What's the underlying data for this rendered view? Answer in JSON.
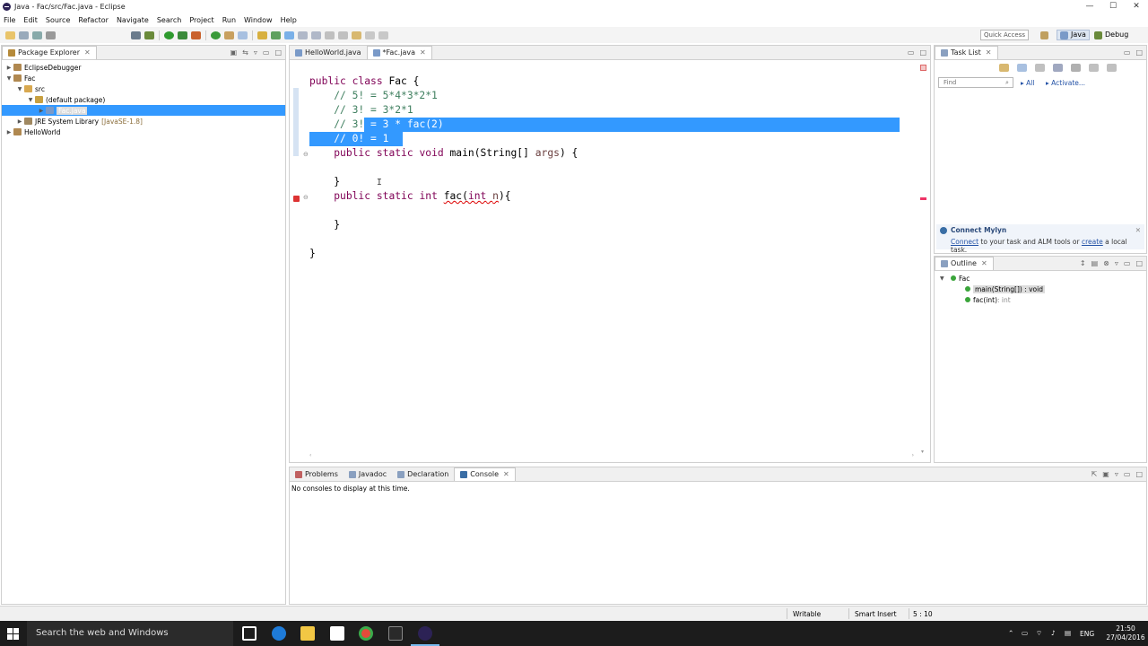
{
  "window": {
    "title": "Java - Fac/src/Fac.java - Eclipse",
    "controls": {
      "minimize": "—",
      "maximize": "☐",
      "close": "✕"
    }
  },
  "menu": [
    "File",
    "Edit",
    "Source",
    "Refactor",
    "Navigate",
    "Search",
    "Project",
    "Run",
    "Window",
    "Help"
  ],
  "toolbar": {
    "quick_access": "Quick Access",
    "perspectives": {
      "java": "Java",
      "debug": "Debug"
    }
  },
  "package_explorer": {
    "tab_label": "Package Explorer",
    "tree": [
      {
        "label": "EclipseDebugger",
        "extra": ""
      },
      {
        "label": "Fac",
        "extra": ""
      },
      {
        "label": "src",
        "extra": ""
      },
      {
        "label": "(default package)",
        "extra": ""
      },
      {
        "label": "Fac.java",
        "extra": ""
      },
      {
        "label": "JRE System Library",
        "extra": "[JavaSE-1.8]"
      },
      {
        "label": "HelloWorld",
        "extra": ""
      }
    ]
  },
  "editor": {
    "tabs": [
      {
        "label": "HelloWorld.java"
      },
      {
        "label": "*Fac.java"
      }
    ],
    "code": {
      "l1a": "public",
      "l1b": " ",
      "l1c": "class",
      "l1d": " Fac {",
      "l2": "// 5! = 5*4*3*2*1",
      "l3": "// 3! = 3*2*1",
      "l4a": "// 3!",
      "l4b": " = 3 * fac(2)",
      "l5": "// 0! = 1",
      "l6a": "public",
      "l6b": "static",
      "l6c": "void",
      "l6d": " main(String[] ",
      "l6e": "args",
      "l6f": ") {",
      "l8": "}",
      "l9a": "public",
      "l9b": "static",
      "l9c": "int",
      "l9d": "fac",
      "l9e": "(",
      "l9f": "int",
      "l9g": " ",
      "l9h": "n",
      "l9i": "){",
      "l11": "}",
      "l13": "}"
    }
  },
  "task_list": {
    "tab_label": "Task List",
    "find_placeholder": "Find",
    "all": "All",
    "activate": "Activate...",
    "mylyn_title": "Connect Mylyn",
    "mylyn_connect": "Connect",
    "mylyn_mid": " to your task and ALM tools or ",
    "mylyn_create": "create",
    "mylyn_end": " a local task."
  },
  "outline": {
    "tab_label": "Outline",
    "class_name": "Fac",
    "items": [
      {
        "name": "main(String[]) : void"
      },
      {
        "name": "fac(int)",
        "type": " : int"
      }
    ]
  },
  "console": {
    "tabs": [
      "Problems",
      "Javadoc",
      "Declaration",
      "Console"
    ],
    "message": "No consoles to display at this time."
  },
  "status": {
    "writable": "Writable",
    "insert_mode": "Smart Insert",
    "position": "5 : 10"
  },
  "taskbar": {
    "search_placeholder": "Search the web and Windows",
    "language": "ENG",
    "time": "21:50",
    "date": "27/04/2016"
  }
}
